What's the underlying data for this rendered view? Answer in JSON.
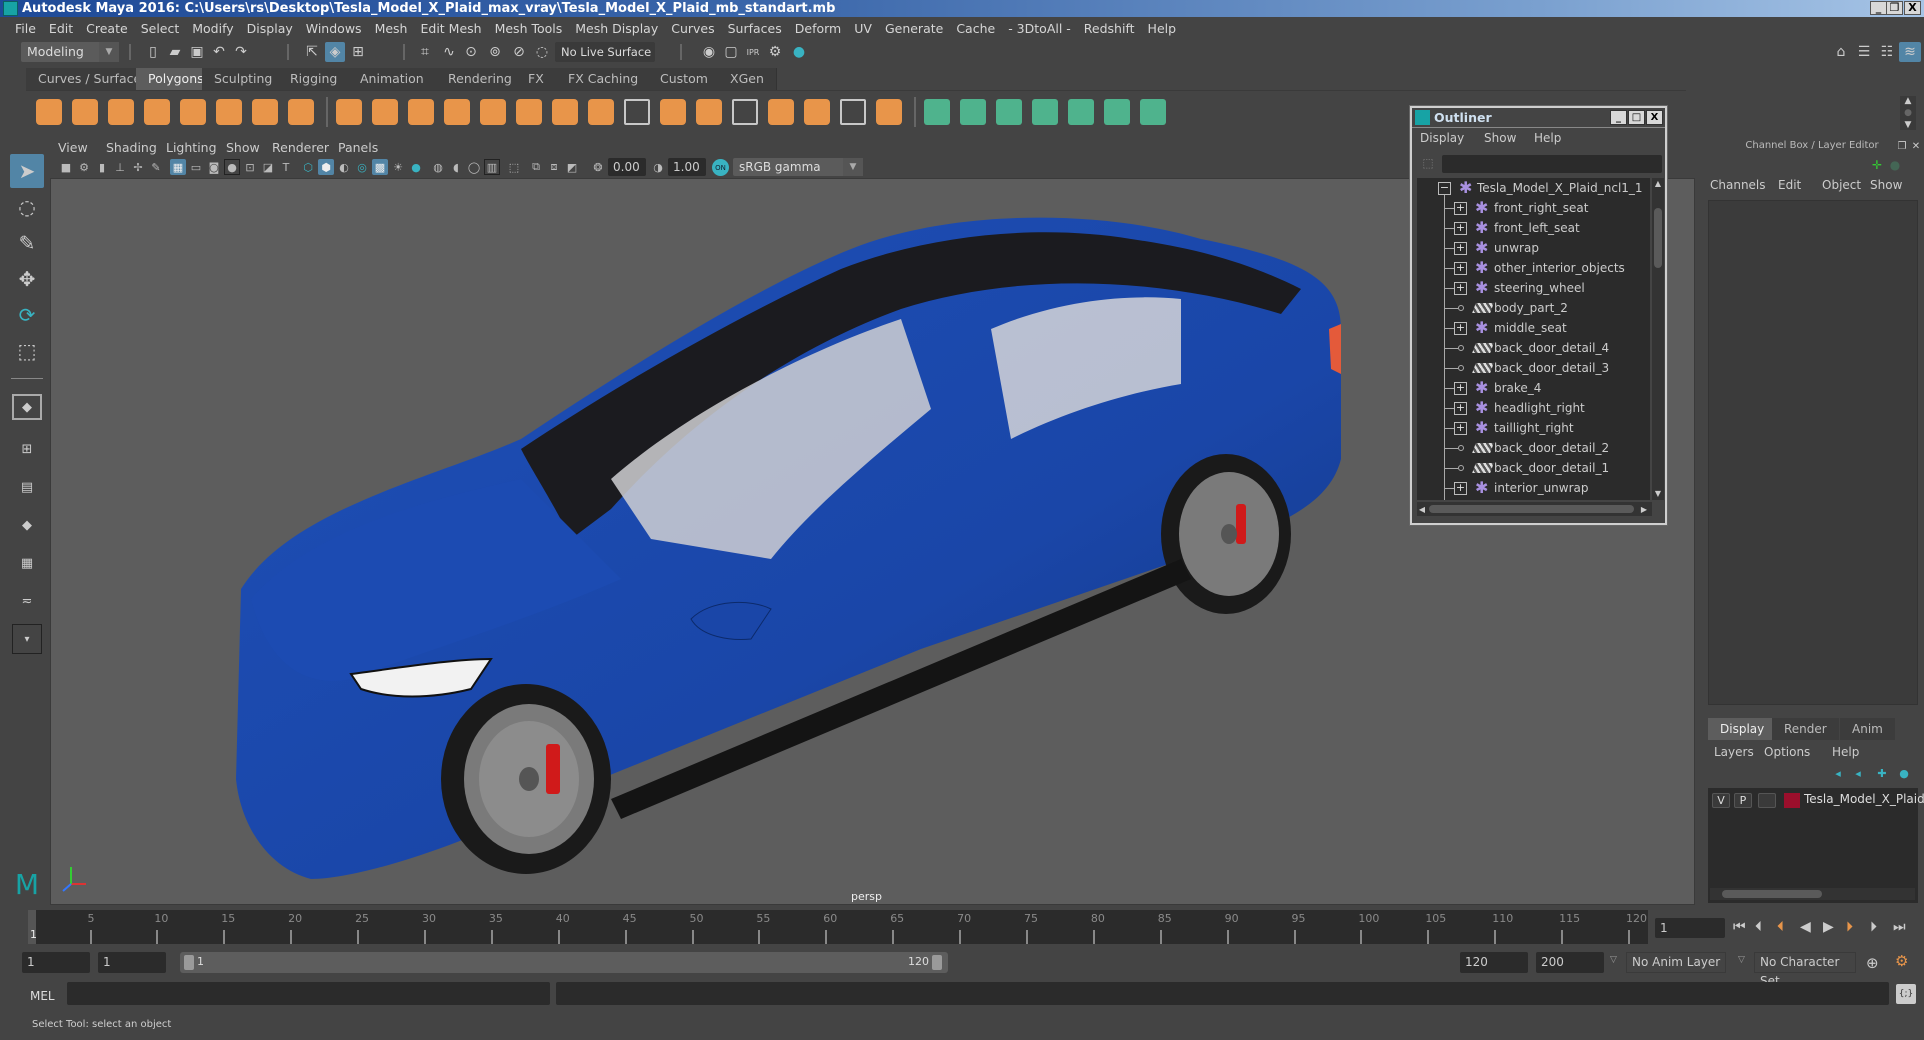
{
  "window": {
    "title": "Autodesk Maya 2016: C:\\Users\\rs\\Desktop\\Tesla_Model_X_Plaid_max_vray\\Tesla_Model_X_Plaid_mb_standart.mb",
    "minimize": "_",
    "restore": "❐",
    "close": "X"
  },
  "menubar": [
    "File",
    "Edit",
    "Create",
    "Select",
    "Modify",
    "Display",
    "Windows",
    "Mesh",
    "Edit Mesh",
    "Mesh Tools",
    "Mesh Display",
    "Curves",
    "Surfaces",
    "Deform",
    "UV",
    "Generate",
    "Cache",
    "- 3DtoAll -",
    "Redshift",
    "Help"
  ],
  "statusline": {
    "menuset": "Modeling",
    "live_surface": "No Live Surface"
  },
  "shelf": {
    "tabs": [
      "Curves / Surfaces",
      "Polygons",
      "Sculpting",
      "Rigging",
      "Animation",
      "Rendering",
      "FX",
      "FX Caching",
      "Custom",
      "XGen"
    ],
    "active_tab": "Polygons"
  },
  "viewport": {
    "menu": [
      "View",
      "Shading",
      "Lighting",
      "Show",
      "Renderer",
      "Panels"
    ],
    "exposure": "0.00",
    "gamma": "1.00",
    "color_management": "ON",
    "color_space": "sRGB gamma",
    "camera_label": "persp",
    "body_color": "#1a46a8"
  },
  "outliner": {
    "title": "Outliner",
    "menu": [
      "Display",
      "Show",
      "Help"
    ],
    "root": "Tesla_Model_X_Plaid_ncl1_1",
    "items": [
      {
        "name": "front_right_seat",
        "type": "group"
      },
      {
        "name": "front_left_seat",
        "type": "group"
      },
      {
        "name": "unwrap",
        "type": "group"
      },
      {
        "name": "other_interior_objects",
        "type": "group"
      },
      {
        "name": "steering_wheel",
        "type": "group"
      },
      {
        "name": "body_part_2",
        "type": "mesh"
      },
      {
        "name": "middle_seat",
        "type": "group"
      },
      {
        "name": "back_door_detail_4",
        "type": "mesh"
      },
      {
        "name": "back_door_detail_3",
        "type": "mesh"
      },
      {
        "name": "brake_4",
        "type": "group"
      },
      {
        "name": "headlight_right",
        "type": "group"
      },
      {
        "name": "taillight_right",
        "type": "group"
      },
      {
        "name": "back_door_detail_2",
        "type": "mesh"
      },
      {
        "name": "back_door_detail_1",
        "type": "mesh"
      },
      {
        "name": "interior_unwrap",
        "type": "group"
      }
    ]
  },
  "channelbox": {
    "title": "Channel Box / Layer Editor",
    "menu": [
      "Channels",
      "Edit",
      "Object",
      "Show"
    ],
    "layer_tabs": [
      "Display",
      "Render",
      "Anim"
    ],
    "active_layer_tab": "Display",
    "layer_menu": [
      "Layers",
      "Options",
      "Help"
    ],
    "layers": [
      {
        "v": "V",
        "p": "P",
        "name": "Tesla_Model_X_Plaid",
        "color": "#9b0f2c"
      }
    ]
  },
  "timeline": {
    "ticks": [
      5,
      10,
      15,
      20,
      25,
      30,
      35,
      40,
      45,
      50,
      55,
      60,
      65,
      70,
      75,
      80,
      85,
      90,
      95,
      100,
      105,
      110,
      115,
      120
    ],
    "range": [
      1,
      120
    ],
    "current_frame": "1",
    "current_frame_field": "1"
  },
  "rangeslider": {
    "start_frame": "1",
    "playback_start": "1",
    "slider_start": "1",
    "slider_end": "120",
    "playback_end": "120",
    "end_frame": "200",
    "anim_layer": "No Anim Layer",
    "character_set": "No Character Set"
  },
  "commandline": {
    "label": "MEL"
  },
  "helpline": "Select Tool: select an object"
}
